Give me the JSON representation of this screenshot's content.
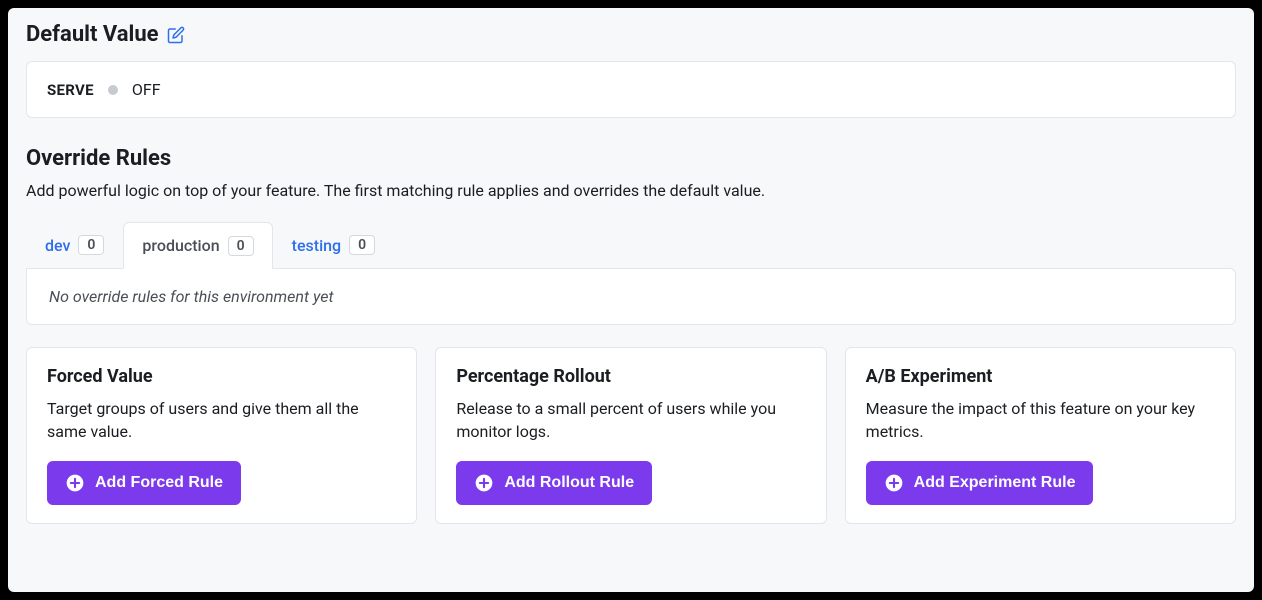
{
  "defaultValue": {
    "title": "Default Value",
    "serveLabel": "SERVE",
    "serveValue": "OFF"
  },
  "overrideRules": {
    "title": "Override Rules",
    "subtitle": "Add powerful logic on top of your feature. The first matching rule applies and overrides the default value.",
    "tabs": [
      {
        "name": "dev",
        "count": "0",
        "active": false
      },
      {
        "name": "production",
        "count": "0",
        "active": true
      },
      {
        "name": "testing",
        "count": "0",
        "active": false
      }
    ],
    "emptyMessage": "No override rules for this environment yet"
  },
  "ruleCards": [
    {
      "title": "Forced Value",
      "description": "Target groups of users and give them all the same value.",
      "buttonLabel": "Add Forced Rule"
    },
    {
      "title": "Percentage Rollout",
      "description": "Release to a small percent of users while you monitor logs.",
      "buttonLabel": "Add Rollout Rule"
    },
    {
      "title": "A/B Experiment",
      "description": "Measure the impact of this feature on your key metrics.",
      "buttonLabel": "Add Experiment Rule"
    }
  ]
}
